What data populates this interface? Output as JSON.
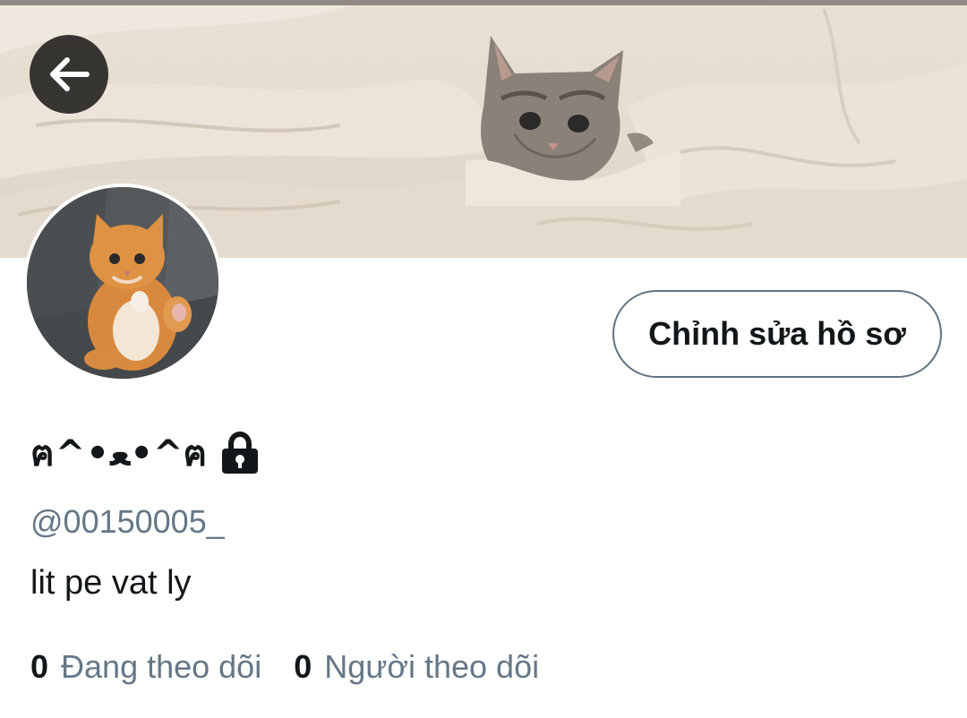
{
  "header": {
    "back_icon": "arrow-left-icon",
    "banner_image": "kitten-in-blanket",
    "banner_colors": {
      "background": "#e6ddd1",
      "top_line": "#8f8a85"
    }
  },
  "profile": {
    "avatar_image": "orange-kitten",
    "display_name": "ฅ^•ﻌ•^ฅ",
    "lock_icon": "lock-icon",
    "handle": "@00150005_",
    "bio": "lit pe vat ly",
    "edit_button_label": "Chỉnh sửa hồ sơ"
  },
  "stats": [
    {
      "count": "0",
      "label": "Đang theo dõi"
    },
    {
      "count": "0",
      "label": "Người theo dõi"
    }
  ],
  "colors": {
    "text_primary": "#14171a",
    "text_secondary": "#657786",
    "button_border": "#5f7382"
  }
}
